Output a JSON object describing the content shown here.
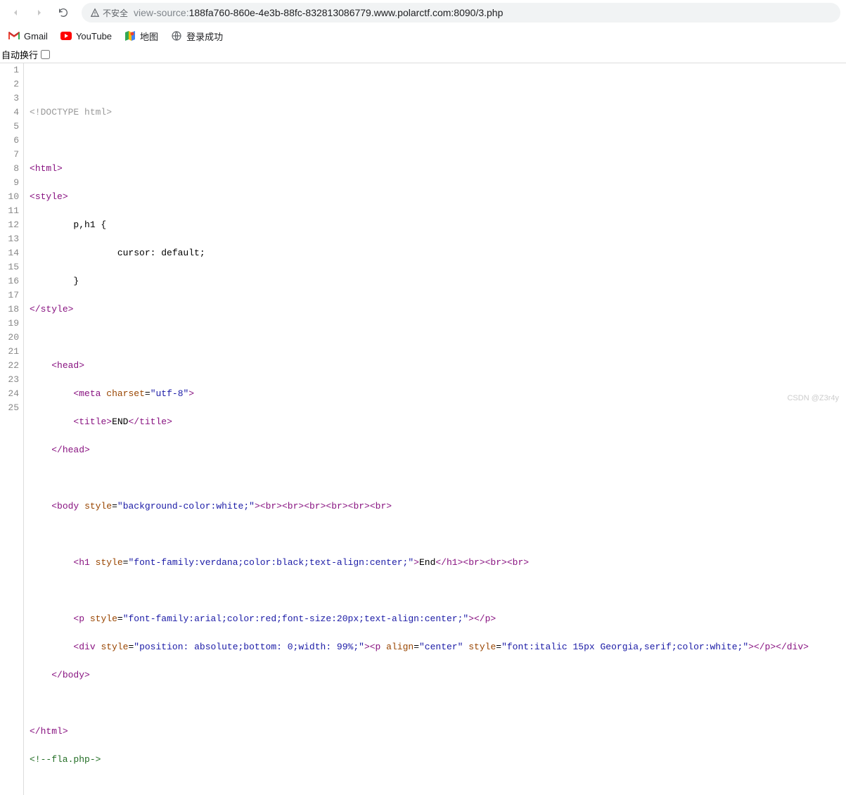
{
  "toolbar": {
    "security_label": "不安全",
    "url_prefix": "view-source:",
    "url_rest": "188fa760-860e-4e3b-88fc-832813086779.www.polarctf.com:8090/3.php"
  },
  "bookmarks": {
    "gmail": "Gmail",
    "youtube": "YouTube",
    "maps": "地图",
    "login": "登录成功"
  },
  "controls": {
    "wrap_label": "自动换行"
  },
  "source": {
    "line_numbers": [
      "1",
      "2",
      "3",
      "4",
      "5",
      "6",
      "7",
      "8",
      "9",
      "10",
      "11",
      "12",
      "13",
      "14",
      "15",
      "16",
      "17",
      "18",
      "19",
      "20",
      "21",
      "22",
      "23",
      "24",
      "25"
    ],
    "l2_doctype": "<!DOCTYPE html>",
    "l4_open_html": "html",
    "l5_open_style": "style",
    "l6": "        p,h1 {",
    "l7": "                cursor: default;",
    "l8": "        }",
    "l9_close_style": "style",
    "l11_head": "head",
    "l12_meta_tag": "meta",
    "l12_meta_attr": "charset",
    "l12_meta_val": "\"utf-8\"",
    "l13_title": "title",
    "l13_text": "END",
    "l14_head_close": "head",
    "l16_body": "body",
    "l16_style_attr": "style",
    "l16_style_val": "\"background-color:white;\"",
    "l16_br": "br",
    "l18_h1": "h1",
    "l18_style_val": "\"font-family:verdana;color:black;text-align:center;\"",
    "l18_text": "End",
    "l20_p": "p",
    "l20_style_val": "\"font-family:arial;color:red;font-size:20px;text-align:center;\"",
    "l21_div": "div",
    "l21_div_style_val": "\"position: absolute;bottom: 0;width: 99%;\"",
    "l21_p_align": "align",
    "l21_p_align_val": "\"center\"",
    "l21_p_style_val": "\"font:italic 15px Georgia,serif;color:white;\"",
    "l22_body_close": "body",
    "l24_html_close": "html",
    "l25_comment": "<!--fla.php->"
  },
  "watermark": "CSDN @Z3r4y"
}
